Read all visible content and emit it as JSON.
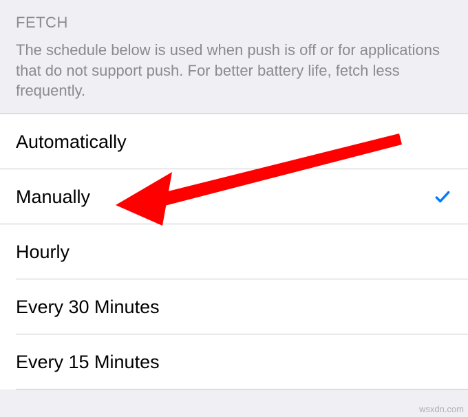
{
  "section": {
    "header": "FETCH",
    "description": "The schedule below is used when push is off or for applications that do not support push. For better battery life, fetch less frequently."
  },
  "options": [
    {
      "label": "Automatically",
      "selected": false
    },
    {
      "label": "Manually",
      "selected": true
    },
    {
      "label": "Hourly",
      "selected": false
    },
    {
      "label": "Every 30 Minutes",
      "selected": false
    },
    {
      "label": "Every 15 Minutes",
      "selected": false
    }
  ],
  "colors": {
    "checkmark": "#007aff",
    "arrow": "#ff0000"
  },
  "watermark": "wsxdn.com"
}
